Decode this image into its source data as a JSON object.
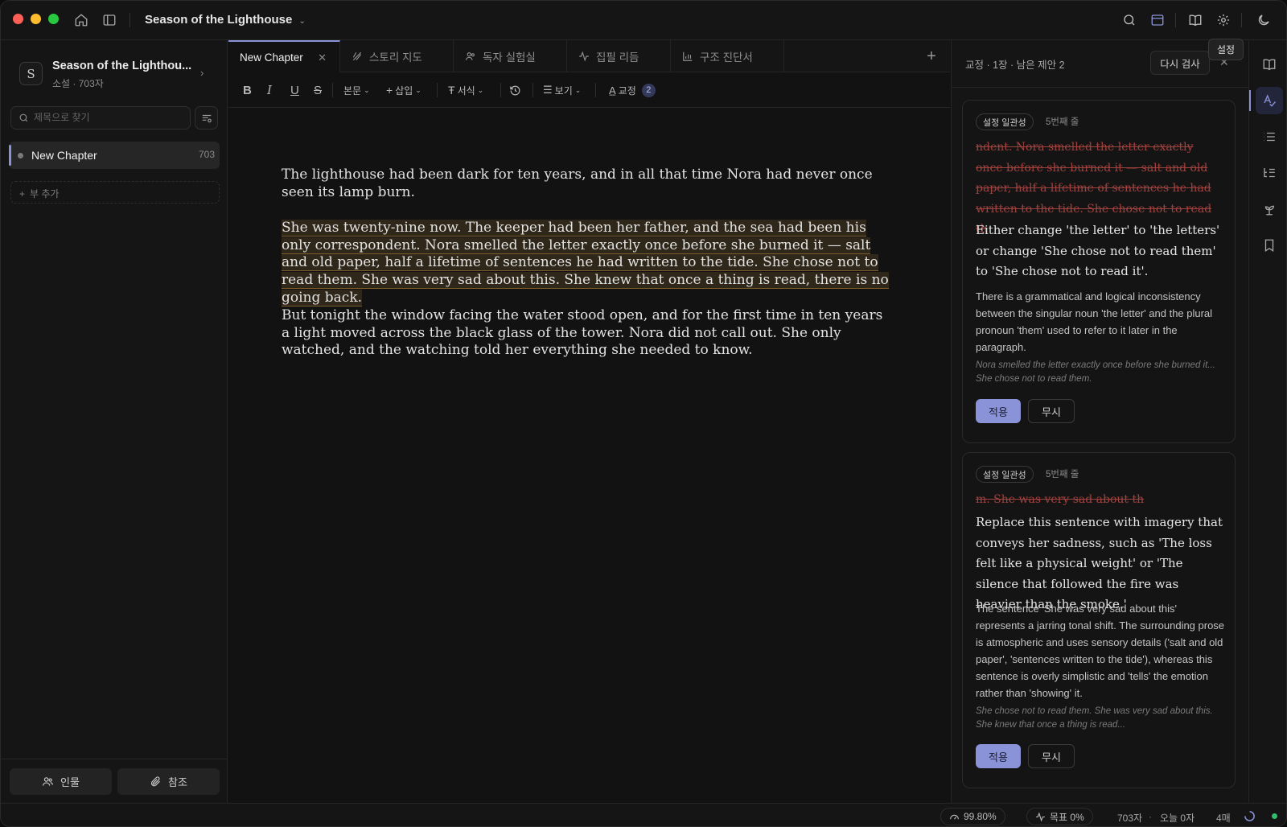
{
  "window": {
    "title": "Season of the Lighthouse",
    "tooltip": "설정"
  },
  "sidebar": {
    "project_initial": "S",
    "project_name": "Season of the Lighthou...",
    "project_meta": "소설 · 703자",
    "search_placeholder": "제목으로 찾기",
    "chapters": [
      {
        "label": "New Chapter",
        "count": "703"
      }
    ],
    "add_sub_label": "부 추가",
    "footer_buttons": [
      "인물",
      "참조"
    ]
  },
  "tabs": [
    {
      "label": "New Chapter",
      "icon": "none",
      "active": true
    },
    {
      "label": "스토리 지도",
      "icon": "story-map-icon"
    },
    {
      "label": "독자 실험실",
      "icon": "readers-icon"
    },
    {
      "label": "집필 리듬",
      "icon": "rhythm-icon"
    },
    {
      "label": "구조 진단서",
      "icon": "chart-icon"
    }
  ],
  "toolbar": {
    "style_label": "본문",
    "insert_label": "삽입",
    "format_label": "서식",
    "view_label": "보기",
    "proof_label": "교정",
    "proof_count": "2"
  },
  "editor": {
    "paragraphs": [
      "The lighthouse had been dark for ten years, and in all that time Nora had never once seen its lamp burn.",
      "She was twenty-nine now. The keeper had been her father, and the sea had been his only correspondent. Nora smelled the letter exactly once before she burned it — salt and old paper, half a lifetime of sentences he had written to the tide. She chose not to read them. She was very sad about this. She knew that once a thing is read, there is no going back.",
      "But tonight the window facing the water stood open, and for the first time in ten years a light moved across the black glass of the tower. Nora did not call out. She only watched, and the watching told her everything she needed to know."
    ]
  },
  "proof_panel": {
    "header": "교정 · 1장 · 남은 제안 2",
    "recheck_label": "다시 검사",
    "cards": [
      {
        "tag": "설정 일관성",
        "line": "5번째 줄",
        "original": "ndent. Nora smelled the letter exactly once before she burned it — salt and old paper, half a lifetime of sentences he had written to the tide. She chose not to read th",
        "suggestion": "Either change 'the letter' to 'the letters' or change 'She chose not to read them' to 'She chose not to read it'.",
        "explanation": "There is a grammatical and logical inconsistency between the singular noun 'the letter' and the plural pronoun 'them' used to refer to it later in the paragraph.",
        "quote": "Nora smelled the letter exactly once before she burned it... She chose not to read them.",
        "apply": "적용",
        "ignore": "무시"
      },
      {
        "tag": "설정 일관성",
        "line": "5번째 줄",
        "original": "m. She was very sad about th",
        "suggestion": "Replace this sentence with imagery that conveys her sadness, such as 'The loss felt like a physical weight' or 'The silence that followed the fire was heavier than the smoke.'",
        "explanation": "The sentence 'She was very sad about this' represents a jarring tonal shift. The surrounding prose is atmospheric and uses sensory details ('salt and old paper', 'sentences written to the tide'), whereas this sentence is overly simplistic and 'tells' the emotion rather than 'showing' it.",
        "quote": "She chose not to read them. She was very sad about this. She knew that once a thing is read...",
        "apply": "적용",
        "ignore": "무시"
      }
    ]
  },
  "statusbar": {
    "score": "99.80%",
    "goal": "목표 0%",
    "chars": "703자",
    "today": "오늘 0자",
    "pages": "4매"
  },
  "colors": {
    "accent": "#8b93d8",
    "highlight": "#c4943e",
    "strike": "#a2423f",
    "background": "#121212"
  }
}
